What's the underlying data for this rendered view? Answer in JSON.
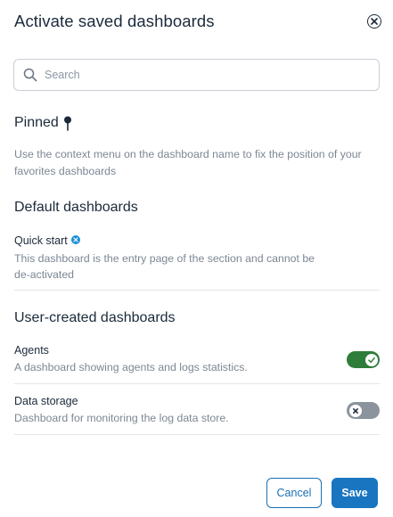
{
  "dialog": {
    "title": "Activate saved dashboards",
    "close_icon": "close-circle-icon"
  },
  "search": {
    "placeholder": "Search",
    "value": "",
    "icon": "search-icon"
  },
  "pinned": {
    "title": "Pinned",
    "icon": "pin-icon",
    "description_line1": "Use the context menu on the dashboard name to fix the position of your",
    "description_line2": "favorites dashboards"
  },
  "default_section": {
    "title": "Default dashboards",
    "items": [
      {
        "name": "Quick start",
        "icon": "info-badge-icon",
        "description_line1": "This dashboard is the entry page of the section and cannot be",
        "description_line2": "de-activated"
      }
    ]
  },
  "user_section": {
    "title": "User-created dashboards",
    "items": [
      {
        "name": "Agents",
        "description": "A dashboard showing agents and logs statistics.",
        "active": true
      },
      {
        "name": "Data storage",
        "description": "Dashboard for monitoring the log data store.",
        "active": false
      }
    ]
  },
  "actions": {
    "cancel_label": "Cancel",
    "save_label": "Save"
  },
  "colors": {
    "accent": "#1a75c0",
    "toggle_on": "#2e7d3a",
    "toggle_off": "#8b939d",
    "info_badge": "#1a8fd6"
  }
}
